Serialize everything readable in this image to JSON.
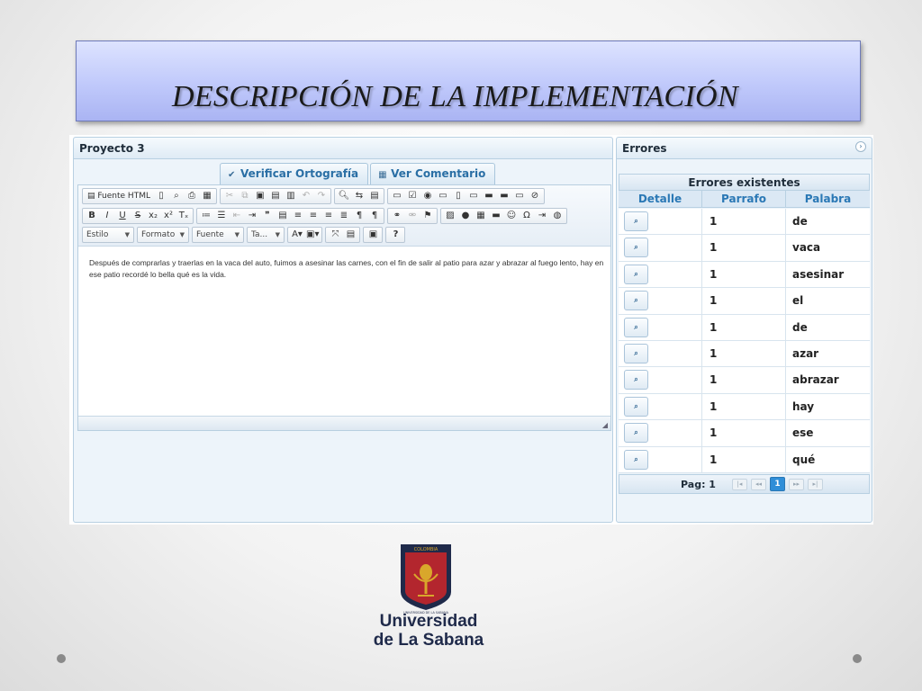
{
  "slide": {
    "title": "DESCRIPCIÓN DE LA IMPLEMENTACIÓN"
  },
  "project_panel": {
    "title": "Proyecto 3",
    "tabs": [
      {
        "icon": "check-icon",
        "label": "Verificar Ortografía"
      },
      {
        "icon": "comment-icon",
        "label": "Ver Comentario"
      }
    ]
  },
  "editor": {
    "source_label": "Fuente HTML",
    "format_selects": [
      "Estilo",
      "Formato",
      "Fuente",
      "Ta..."
    ],
    "content": "Después de comprarlas y traerlas en la vaca del auto, fuimos a asesinar las carnes, con el fin de salir al patio para azar y abrazar al fuego lento, hay en ese patio recordé lo bella qué es la vida."
  },
  "errors_panel": {
    "title": "Errores",
    "table_title": "Errores existentes",
    "columns": [
      "Detalle",
      "Parrafo",
      "Palabra"
    ],
    "rows": [
      {
        "parrafo": "1",
        "palabra": "de"
      },
      {
        "parrafo": "1",
        "palabra": "vaca"
      },
      {
        "parrafo": "1",
        "palabra": "asesinar"
      },
      {
        "parrafo": "1",
        "palabra": "el"
      },
      {
        "parrafo": "1",
        "palabra": "de"
      },
      {
        "parrafo": "1",
        "palabra": "azar"
      },
      {
        "parrafo": "1",
        "palabra": "abrazar"
      },
      {
        "parrafo": "1",
        "palabra": "hay"
      },
      {
        "parrafo": "1",
        "palabra": "ese"
      },
      {
        "parrafo": "1",
        "palabra": "qué"
      }
    ],
    "pager": {
      "label": "Pag: 1",
      "current_page": "1"
    }
  },
  "logo": {
    "seal_top": "COLOMBIA",
    "seal_ring": "UNIVERSIDAD DE LA SABANA",
    "line1": "Universidad",
    "line2": "de La Sabana"
  },
  "colors": {
    "title_banner": "#c0c9fb",
    "panel_bg": "#edf4fa",
    "accent_blue": "#2a78b5",
    "seal_red": "#b3262e",
    "seal_navy": "#1f2a4a",
    "seal_gold": "#d9a72b"
  }
}
